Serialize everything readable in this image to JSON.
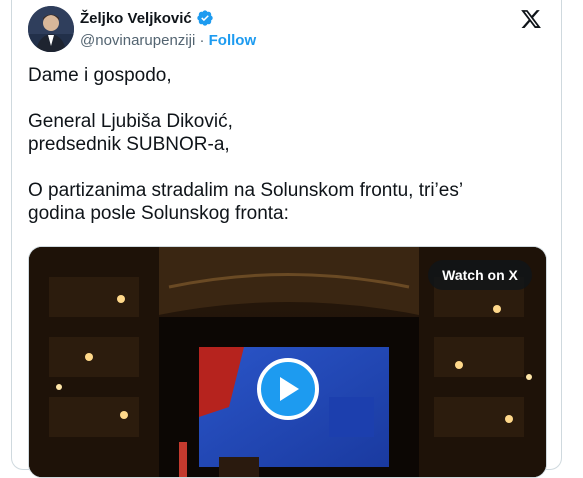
{
  "tweet": {
    "author_name": "Željko Veljković",
    "handle": "@novinarupenziji",
    "separator": "·",
    "follow_label": "Follow",
    "text_lines": [
      "Dame i gospodo,",
      "General Ljubiša Diković,",
      "predsednik SUBNOR-a,",
      "O partizanima stradalim na Solunskom frontu, tri’es’",
      "godina posle Solunskog fronta:"
    ],
    "media": {
      "watch_label": "Watch on X",
      "play_icon": "play-icon"
    }
  },
  "colors": {
    "accent": "#1d9bf0",
    "text": "#0f1419",
    "muted": "#536471",
    "border": "#cfd9de"
  }
}
